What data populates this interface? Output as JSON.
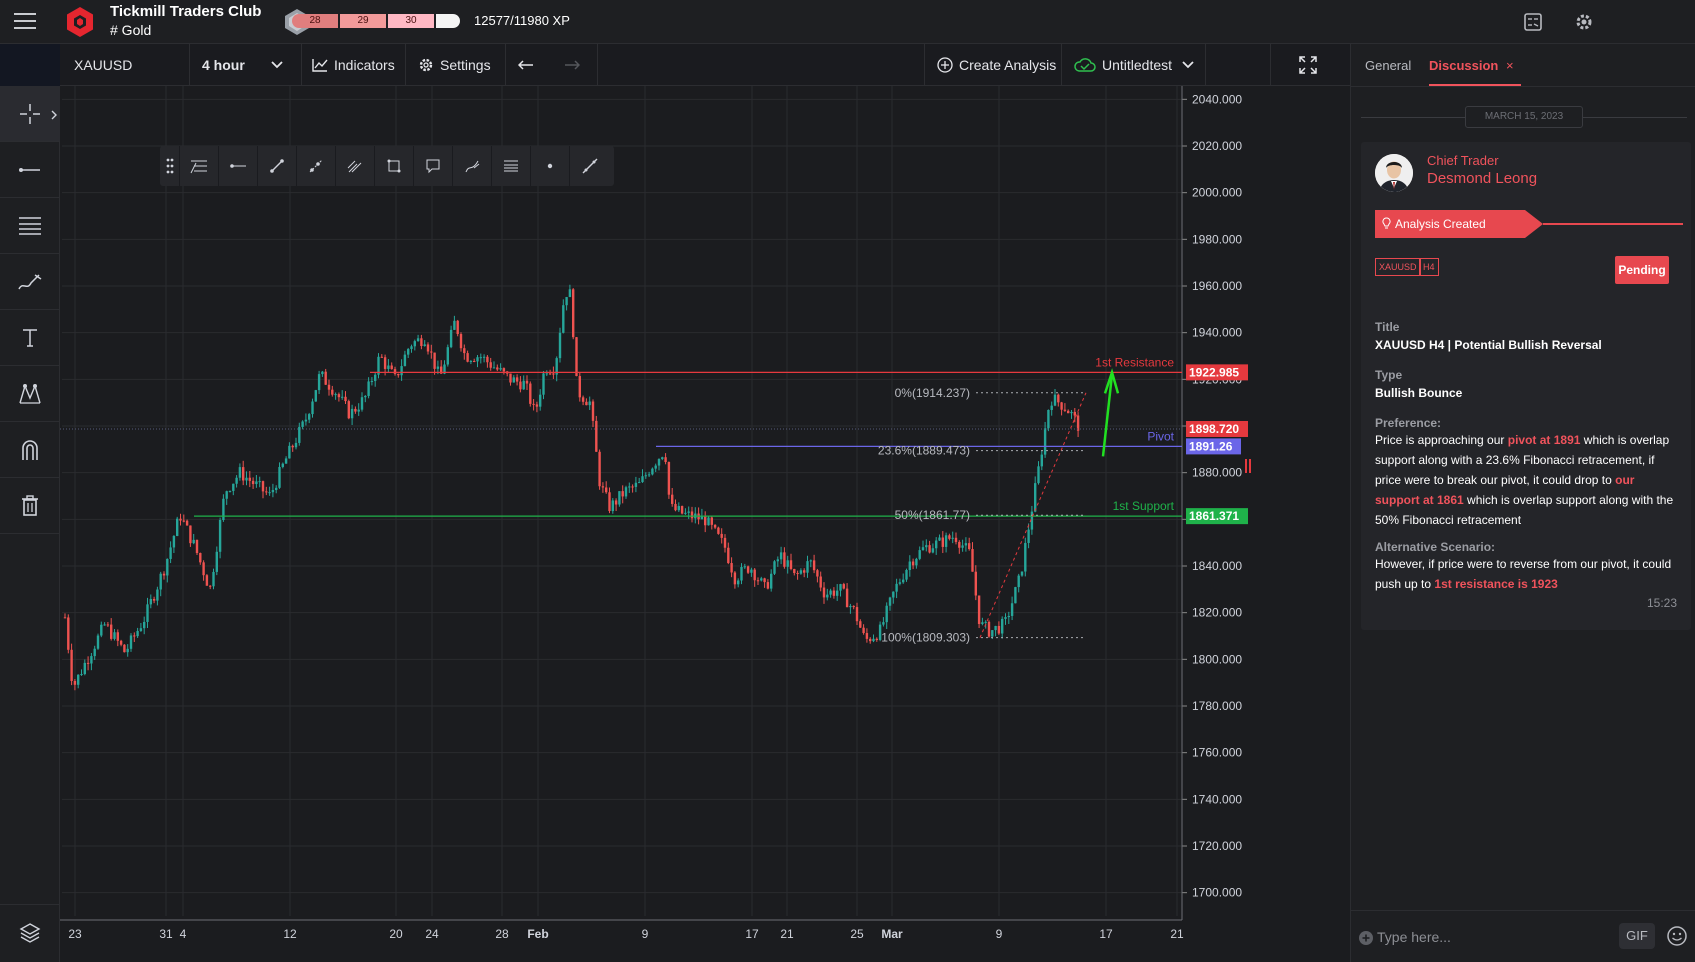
{
  "header": {
    "club_title": "Tickmill Traders Club",
    "channel": "# Gold",
    "xp_segments": [
      "28",
      "29",
      "30"
    ],
    "xp_text": "12577/11980 XP"
  },
  "toolbar": {
    "symbol": "XAUUSD",
    "timeframe": "4 hour",
    "indicators": "Indicators",
    "settings": "Settings",
    "create_analysis": "Create Analysis",
    "layout_name": "Untitledtest"
  },
  "chart_data": {
    "type": "candlestick",
    "price_ticks": [
      "2040.000",
      "2020.000",
      "2000.000",
      "1980.000",
      "1960.000",
      "1940.000",
      "1920.000",
      "1900.000",
      "1880.000",
      "1860.000",
      "1840.000",
      "1820.000",
      "1800.000",
      "1780.000",
      "1760.000",
      "1740.000",
      "1720.000",
      "1700.000"
    ],
    "time_ticks": [
      "23",
      "31",
      "4",
      "12",
      "20",
      "24",
      "28",
      "Feb",
      "9",
      "17",
      "21",
      "25",
      "Mar",
      "9",
      "17",
      "21"
    ],
    "levels": [
      {
        "label": "1st Resistance",
        "value": 1922.985,
        "price_tag": "1922.985",
        "color": "#e5393e"
      },
      {
        "label": "Pivot",
        "value": 1891.26,
        "price_tag": "1891.26",
        "color": "#6b66e8"
      },
      {
        "label": "1st Support",
        "value": 1861.371,
        "price_tag": "1861.371",
        "color": "#1fb24a"
      }
    ],
    "current_price": {
      "value": 1898.72,
      "price_tag": "1898.720",
      "color": "#e5393e"
    },
    "fibonacci": [
      {
        "label": "0%(1914.237)",
        "value": 1914.237
      },
      {
        "label": "23.6%(1889.473)",
        "value": 1889.473
      },
      {
        "label": "50%(1861.77)",
        "value": 1861.77
      },
      {
        "label": "100%(1809.303)",
        "value": 1809.303
      }
    ],
    "ylim": [
      1690,
      2044
    ],
    "candle_colors": {
      "up": "#26a69a",
      "down": "#ef5350"
    },
    "price_path": [
      [
        0,
        1818
      ],
      [
        8,
        1788
      ],
      [
        22,
        1800
      ],
      [
        40,
        1815
      ],
      [
        60,
        1803
      ],
      [
        80,
        1818
      ],
      [
        100,
        1840
      ],
      [
        115,
        1862
      ],
      [
        130,
        1848
      ],
      [
        145,
        1830
      ],
      [
        160,
        1872
      ],
      [
        175,
        1880
      ],
      [
        190,
        1875
      ],
      [
        205,
        1870
      ],
      [
        220,
        1885
      ],
      [
        240,
        1902
      ],
      [
        255,
        1922
      ],
      [
        270,
        1915
      ],
      [
        285,
        1905
      ],
      [
        300,
        1912
      ],
      [
        315,
        1930
      ],
      [
        330,
        1920
      ],
      [
        345,
        1935
      ],
      [
        360,
        1938
      ],
      [
        375,
        1920
      ],
      [
        390,
        1945
      ],
      [
        400,
        1930
      ],
      [
        415,
        1930
      ],
      [
        430,
        1925
      ],
      [
        445,
        1920
      ],
      [
        460,
        1918
      ],
      [
        470,
        1905
      ],
      [
        480,
        1925
      ],
      [
        490,
        1925
      ],
      [
        500,
        1958
      ],
      [
        506,
        1956
      ],
      [
        512,
        1915
      ],
      [
        525,
        1910
      ],
      [
        535,
        1875
      ],
      [
        545,
        1865
      ],
      [
        560,
        1872
      ],
      [
        575,
        1875
      ],
      [
        585,
        1882
      ],
      [
        600,
        1890
      ],
      [
        605,
        1865
      ],
      [
        620,
        1862
      ],
      [
        640,
        1860
      ],
      [
        660,
        1848
      ],
      [
        670,
        1835
      ],
      [
        685,
        1840
      ],
      [
        700,
        1830
      ],
      [
        715,
        1845
      ],
      [
        730,
        1835
      ],
      [
        745,
        1842
      ],
      [
        760,
        1828
      ],
      [
        775,
        1830
      ],
      [
        790,
        1820
      ],
      [
        800,
        1808
      ],
      [
        815,
        1812
      ],
      [
        830,
        1830
      ],
      [
        845,
        1842
      ],
      [
        860,
        1848
      ],
      [
        875,
        1850
      ],
      [
        890,
        1853
      ],
      [
        905,
        1845
      ],
      [
        915,
        1815
      ],
      [
        925,
        1812
      ],
      [
        940,
        1815
      ],
      [
        955,
        1835
      ],
      [
        965,
        1860
      ],
      [
        975,
        1885
      ],
      [
        985,
        1912
      ],
      [
        995,
        1910
      ],
      [
        1005,
        1906
      ],
      [
        1015,
        1899
      ]
    ]
  },
  "panel": {
    "tab_general": "General",
    "tab_discussion": "Discussion",
    "tab_close": "×",
    "date": "MARCH 15, 2023",
    "role": "Chief Trader",
    "author": "Desmond Leong",
    "analysis_tag": "Analysis Created",
    "tag_symbol": "XAUUSD",
    "tag_tf": "H4",
    "status": "Pending",
    "title_label": "Title",
    "title_value": "XAUUSD H4 | Potential Bullish Reversal",
    "type_label": "Type",
    "type_value": "Bullish Bounce",
    "pref_label": "Preference:",
    "pref_1": "Price is approaching our ",
    "pref_hl_1": "pivot at 1891",
    "pref_2": " which is overlap support along with a 23.6% Fibonacci retracement, if price were to break our pivot, it could drop to ",
    "pref_hl_2": "our support at 1861",
    "pref_3": " which is overlap support along with the 50% Fibonacci retracement",
    "alt_label": "Alternative Scenario:",
    "alt_1": "However, if price were to reverse from our pivot, it could push up to ",
    "alt_hl": "1st resistance is 1923",
    "time": "15:23",
    "input_placeholder": "Type here...",
    "gif": "GIF"
  }
}
